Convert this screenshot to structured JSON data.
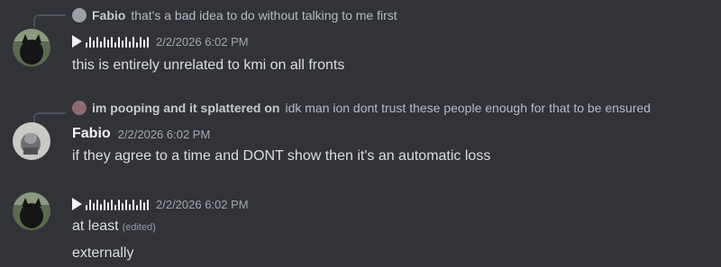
{
  "messages": [
    {
      "reply": {
        "author": "Fabio",
        "text": "that's a bad idea to do without talking to me first"
      },
      "author_display": "voice-message",
      "timestamp": "2/2/2026 6:02 PM",
      "lines": [
        "this is entirely unrelated to kmi on all fronts"
      ]
    },
    {
      "reply": {
        "author": "im pooping and it splattered on",
        "text": "idk man ion dont trust these people enough for that to be ensured"
      },
      "author": "Fabio",
      "timestamp": "2/2/2026 6:02 PM",
      "lines": [
        "if they agree to a time and DONT show then it's an automatic loss"
      ]
    },
    {
      "author_display": "voice-message",
      "timestamp": "2/2/2026 6:02 PM",
      "lines": [
        "at least",
        "externally"
      ],
      "edited_label": "(edited)"
    }
  ],
  "colors": {
    "background": "#323339",
    "text": "#dbdee1",
    "muted": "#a3a6ad",
    "name": "#f2f3f5"
  }
}
